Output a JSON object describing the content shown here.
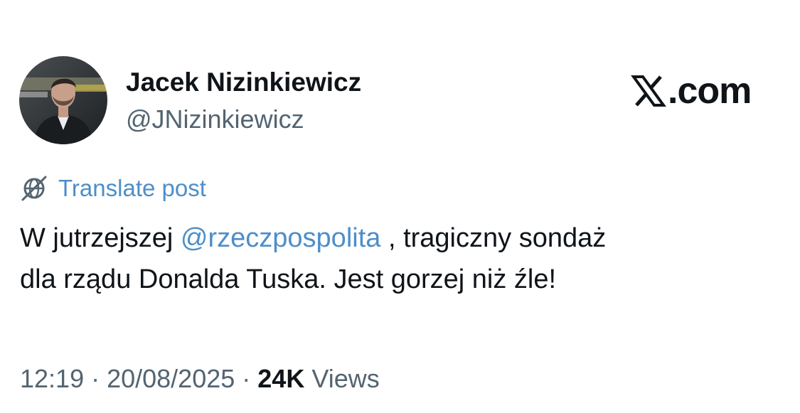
{
  "author": {
    "name": "Jacek Nizinkiewicz",
    "handle": "@JNizinkiewicz"
  },
  "brand": {
    "label": ".com",
    "icon": "x-logo-icon"
  },
  "translate": {
    "icon": "globe-icon",
    "label": "Translate post"
  },
  "post": {
    "text_before": "W jutrzejszej ",
    "mention": "@rzeczpospolita",
    "line1_after": " , tragiczny sondaż",
    "line2": "dla rządu Donalda Tuska. Jest gorzej niż źle!"
  },
  "meta": {
    "time": "12:19",
    "separator": " · ",
    "date": "20/08/2025",
    "views_count": "24K",
    "views_label": " Views"
  },
  "colors": {
    "link": "#4d8ec9",
    "text": "#0f1419",
    "secondary": "#536471"
  }
}
